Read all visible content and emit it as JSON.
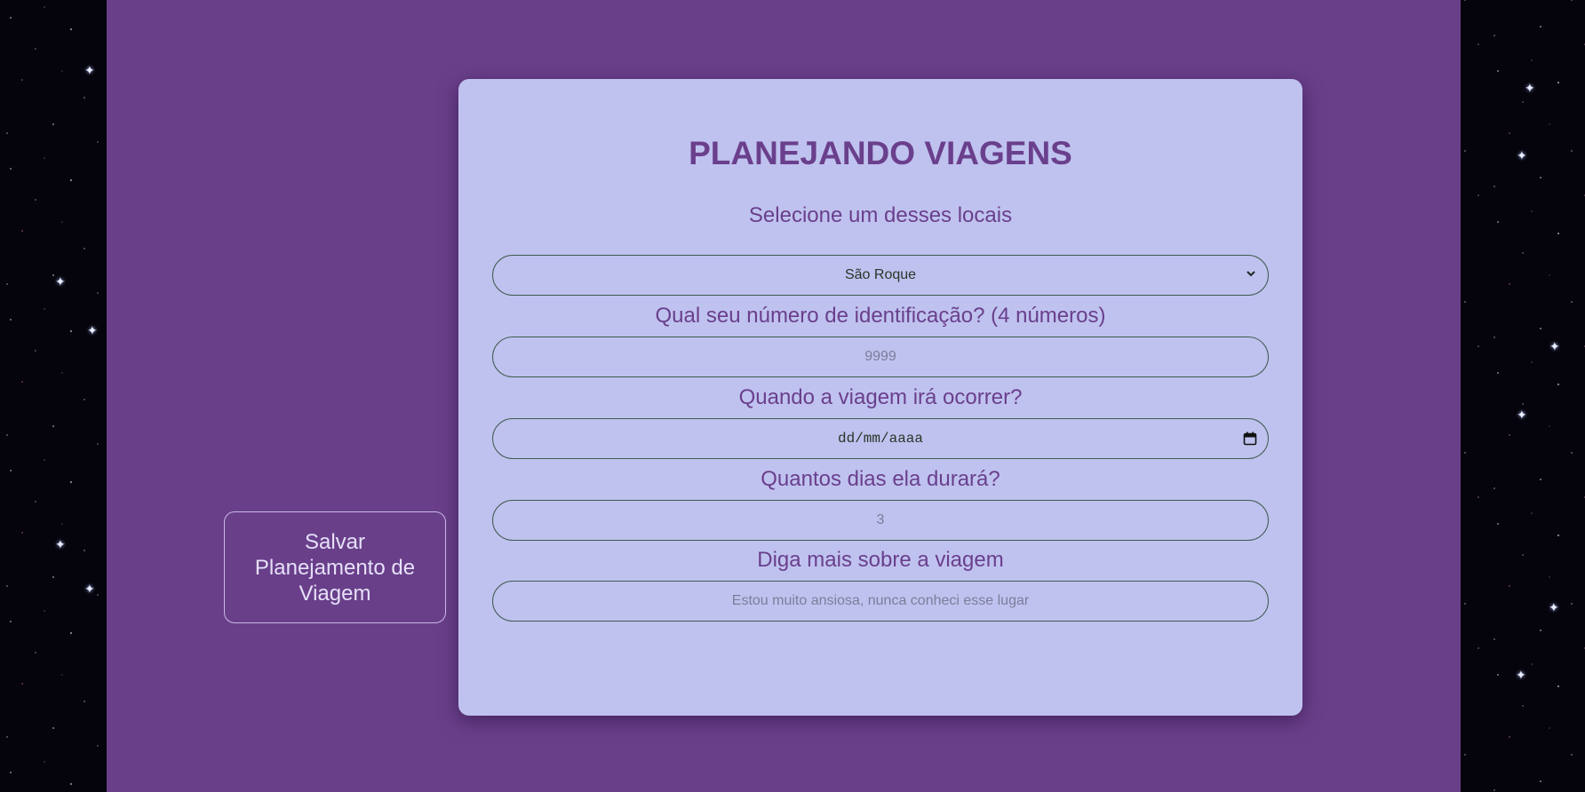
{
  "form": {
    "title": "PLANEJANDO VIAGENS",
    "subtitle": "Selecione um desses locais",
    "location_select": {
      "selected": "São Roque"
    },
    "id_label": "Qual seu número de identificação? (4 números)",
    "id_placeholder": "9999",
    "date_label": "Quando a viagem irá ocorrer?",
    "date_placeholder": "dd/mm/aaaa",
    "days_label": "Quantos dias ela durará?",
    "days_placeholder": "3",
    "notes_label": "Diga mais sobre a viagem",
    "notes_placeholder": "Estou muito ansiosa, nunca conheci esse lugar"
  },
  "actions": {
    "save_label": "Salvar Planejamento de Viagem"
  },
  "colors": {
    "page_background": "#693f8a",
    "card_background": "#bfc2ef",
    "accent_text": "#6a3f8c"
  }
}
